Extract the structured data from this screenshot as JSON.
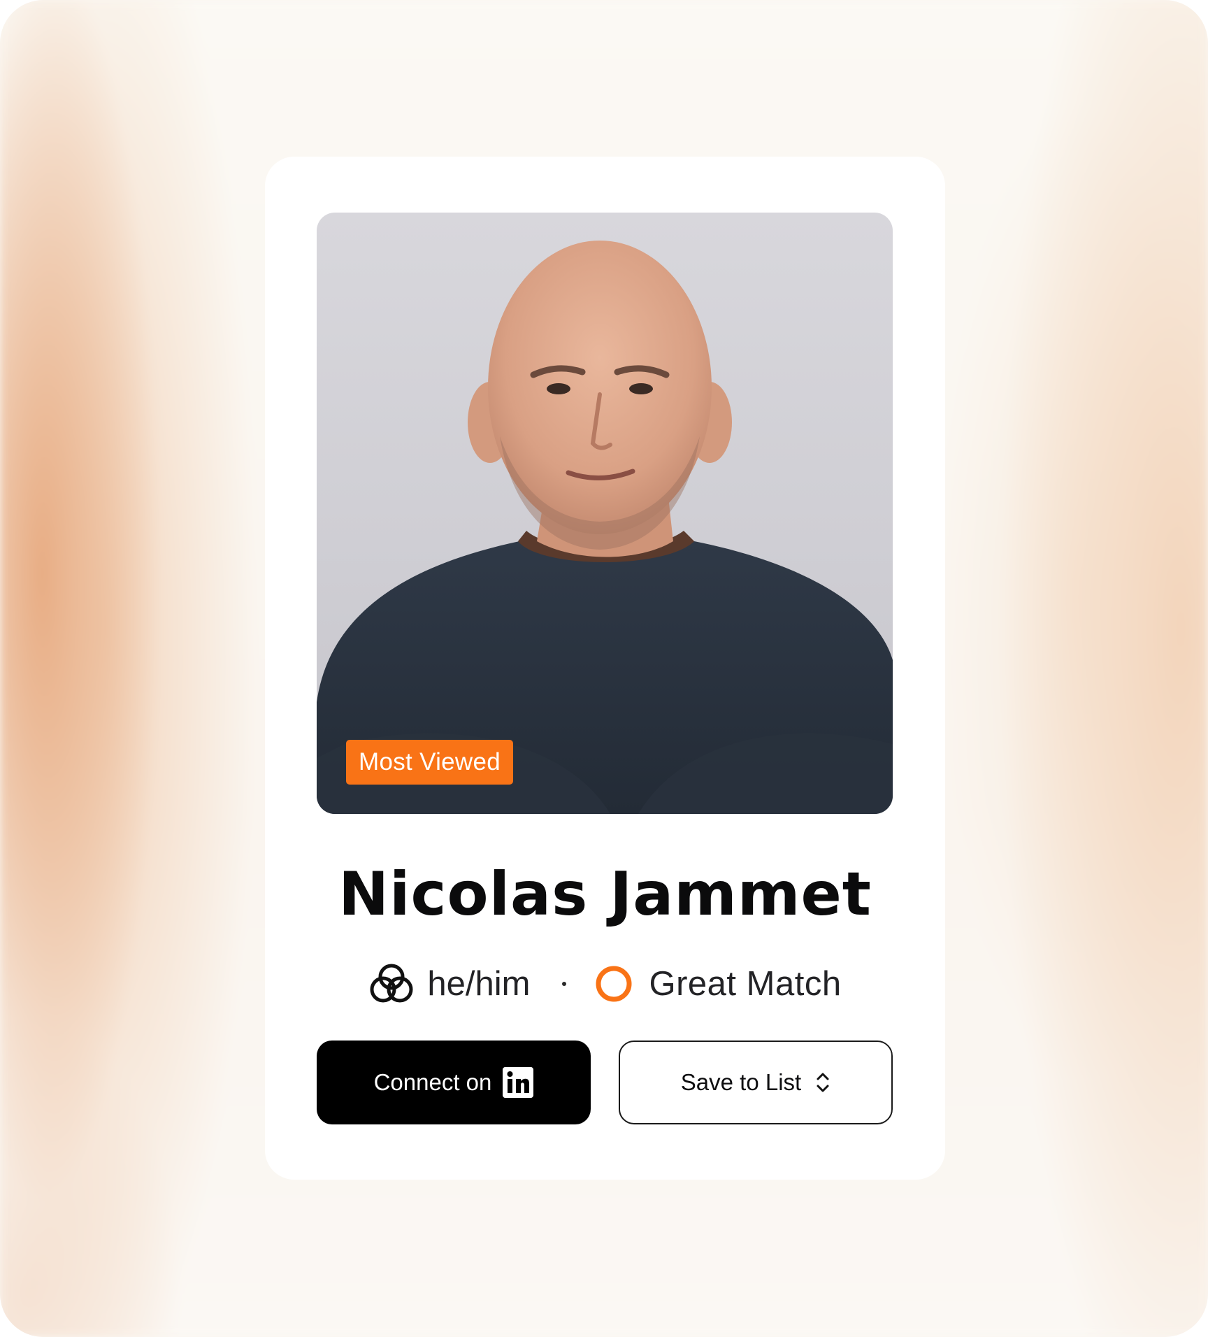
{
  "profile": {
    "name": "Nicolas Jammet",
    "badge": "Most Viewed",
    "pronouns": "he/him",
    "match_label": "Great Match",
    "pronouns_icon": "venn-circles-icon",
    "match_icon": "ring-icon"
  },
  "actions": {
    "connect_label": "Connect on",
    "connect_icon": "linkedin-icon",
    "save_label": "Save to List",
    "save_icon": "chevron-up-down-icon"
  },
  "colors": {
    "accent": "#f97316",
    "primary_button": "#000000",
    "card": "#ffffff"
  }
}
